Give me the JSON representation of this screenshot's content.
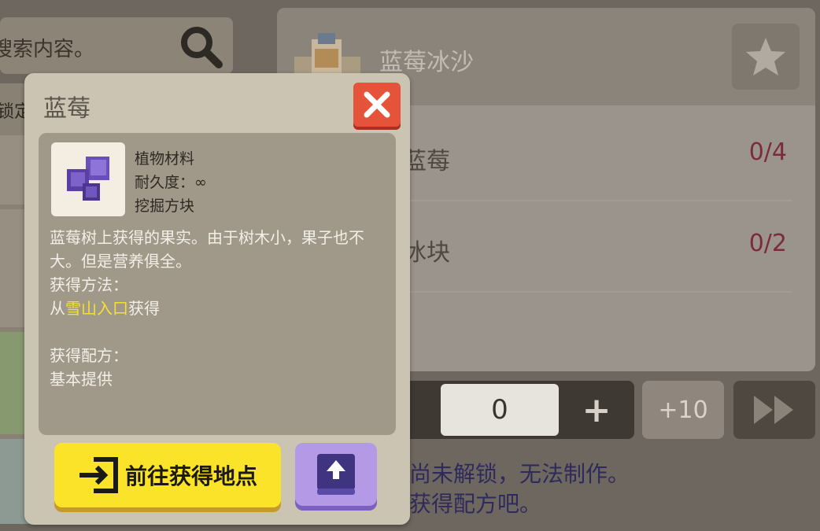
{
  "search": {
    "text": "搜索内容。"
  },
  "left_panel": {
    "lock_label": "锁定"
  },
  "recipe": {
    "title": "蓝莓冰沙",
    "ingredients": [
      {
        "name": "蓝莓",
        "count": "0/4"
      },
      {
        "name": "冰块",
        "count": "0/2"
      }
    ],
    "quantity": "0",
    "plus_label": "+",
    "plus10_label": "+10",
    "locked_message": [
      "尚未解锁，无法制作。",
      "获得配方吧。"
    ]
  },
  "dialog": {
    "title": "蓝莓",
    "category": "植物材料",
    "durability": "耐久度：∞",
    "tool": "挖掘方块",
    "description": "蓝莓树上获得的果实。由于树木小，果子也不大。但是营养俱全。",
    "obtain_heading": "获得方法：",
    "obtain_prefix": "从",
    "obtain_location": "雪山入口",
    "obtain_suffix": "获得",
    "recipe_heading": "获得配方：",
    "recipe_value": "基本提供",
    "goto_label": "前往获得地点"
  },
  "colors": {
    "close": "#e5533a",
    "goto": "#fbe32a",
    "share": "#b49ae6",
    "highlight": "#f5e133",
    "count": "#7c2b3c"
  },
  "icons": [
    "search-icon",
    "star-icon",
    "close-icon",
    "enter-icon",
    "upload-icon",
    "fast-forward-icon",
    "plus-icon"
  ]
}
